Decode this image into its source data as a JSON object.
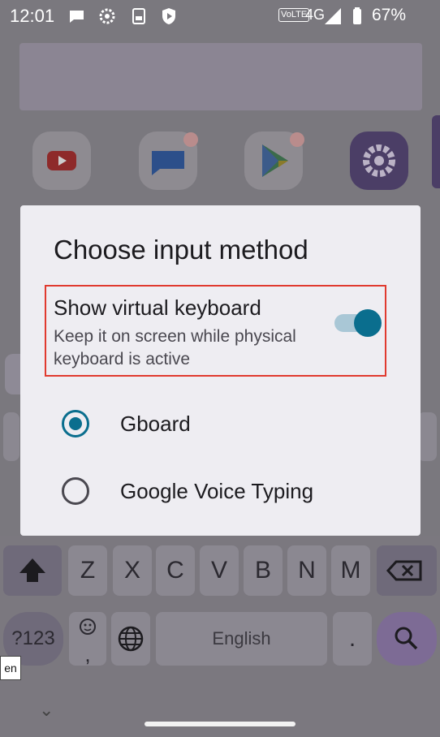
{
  "status_bar": {
    "time": "12:01",
    "volte": "VoLTE",
    "network": "4G",
    "battery": "67%"
  },
  "dialog": {
    "title": "Choose input method",
    "virtual_keyboard": {
      "title": "Show virtual keyboard",
      "subtitle": "Keep it on screen while physical keyboard is active",
      "enabled": true
    },
    "options": [
      {
        "label": "Gboard",
        "selected": true
      },
      {
        "label": "Google Voice Typing",
        "selected": false
      }
    ]
  },
  "keyboard": {
    "row_letters": [
      "Z",
      "X",
      "C",
      "V",
      "B",
      "N",
      "M"
    ],
    "symbols_key": "?123",
    "space_label": "English",
    "period": ".",
    "emoji_comma": ",",
    "lang_indicator": "en"
  },
  "colors": {
    "accent": "#0a6e8e",
    "highlight": "#e03a2f",
    "dialog_bg": "#eeedf2"
  }
}
